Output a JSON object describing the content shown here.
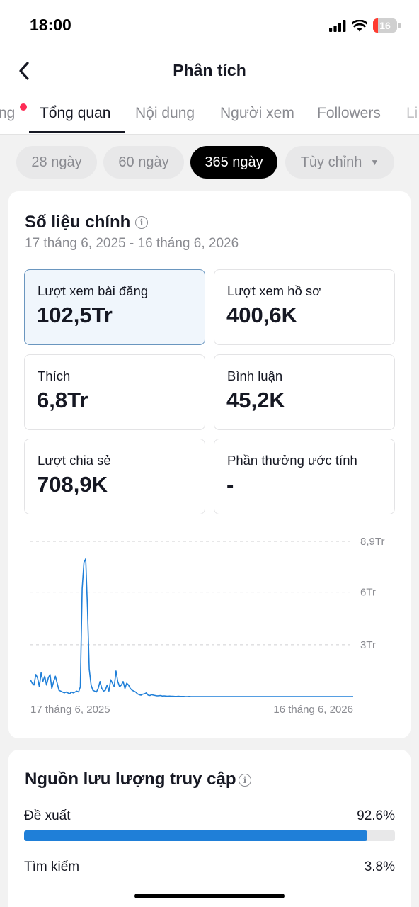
{
  "status_bar": {
    "time": "18:00",
    "battery": "16",
    "icons": [
      "signal-icon",
      "wifi-icon",
      "battery-icon"
    ]
  },
  "header": {
    "title": "Phân tích",
    "back_icon": "chevron-left-icon"
  },
  "tabs": [
    {
      "label": "ng",
      "active": false
    },
    {
      "label": "Tổng quan",
      "active": true
    },
    {
      "label": "Nội dung",
      "active": false
    },
    {
      "label": "Người xem",
      "active": false
    },
    {
      "label": "Followers",
      "active": false
    },
    {
      "label": "Li",
      "active": false
    }
  ],
  "periods": [
    {
      "label": "28 ngày",
      "active": false
    },
    {
      "label": "60 ngày",
      "active": false
    },
    {
      "label": "365 ngày",
      "active": true
    },
    {
      "label": "Tùy chỉnh",
      "active": false,
      "dropdown": true
    }
  ],
  "key_metrics": {
    "title": "Số liệu chính",
    "date_range": "17 tháng 6, 2025 - 16 tháng 6, 2026",
    "cards": [
      {
        "label": "Lượt xem bài đăng",
        "value": "102,5Tr",
        "selected": true
      },
      {
        "label": "Lượt xem hồ sơ",
        "value": "400,6K",
        "selected": false
      },
      {
        "label": "Thích",
        "value": "6,8Tr",
        "selected": false
      },
      {
        "label": "Bình luận",
        "value": "45,2K",
        "selected": false
      },
      {
        "label": "Lượt chia sẻ",
        "value": "708,9K",
        "selected": false
      },
      {
        "label": "Phần thưởng ước tính",
        "value": "-",
        "selected": false
      }
    ]
  },
  "chart_data": {
    "type": "line",
    "title": "",
    "xlabel": "",
    "ylabel": "",
    "y_ticks": [
      "8,9Tr",
      "6Tr",
      "3Tr"
    ],
    "x_ticks": [
      "17 tháng 6, 2025",
      "16 tháng 6, 2026"
    ],
    "ylim": [
      0,
      8.9
    ],
    "unit": "Tr",
    "grid": "dashed horizontal",
    "color": "#1f7fd8",
    "series": [
      {
        "values": [
          1.0,
          0.8,
          0.7,
          1.3,
          1.1,
          0.6,
          1.4,
          0.9,
          1.2,
          0.7,
          1.1,
          1.3,
          0.5,
          0.9,
          1.2,
          0.8,
          0.4,
          0.35,
          0.3,
          0.25,
          0.3,
          0.25,
          0.2,
          0.3,
          0.25,
          0.3,
          0.35,
          0.3,
          0.6,
          6.2,
          7.7,
          7.9,
          5.1,
          1.6,
          0.7,
          0.4,
          0.35,
          0.3,
          0.5,
          0.9,
          0.5,
          0.35,
          0.4,
          0.7,
          0.35,
          1.0,
          0.8,
          0.6,
          1.5,
          0.9,
          0.6,
          0.7,
          0.9,
          0.5,
          0.8,
          0.7,
          0.5,
          0.4,
          0.35,
          0.3,
          0.2,
          0.15,
          0.12,
          0.18,
          0.2,
          0.25,
          0.12,
          0.1,
          0.15,
          0.12,
          0.1,
          0.08,
          0.09,
          0.1,
          0.07,
          0.08,
          0.07,
          0.06,
          0.07,
          0.06,
          0.06,
          0.05,
          0.05,
          0.06,
          0.05,
          0.05,
          0.05,
          0.04,
          0.04,
          0.05,
          0.04,
          0.04,
          0.04,
          0.04,
          0.04,
          0.04,
          0.04,
          0.04,
          0.04,
          0.04,
          0.04,
          0.04,
          0.04,
          0.04,
          0.04,
          0.04,
          0.04,
          0.04,
          0.04,
          0.04,
          0.04,
          0.04,
          0.04,
          0.04,
          0.04,
          0.04,
          0.04,
          0.04,
          0.04,
          0.04,
          0.04,
          0.04,
          0.04,
          0.04,
          0.04,
          0.04,
          0.04,
          0.04,
          0.04,
          0.04,
          0.04,
          0.04,
          0.04,
          0.04,
          0.04,
          0.04,
          0.04,
          0.04,
          0.04,
          0.04,
          0.04,
          0.04,
          0.04,
          0.04,
          0.04,
          0.04,
          0.04,
          0.04,
          0.04,
          0.04,
          0.04,
          0.04,
          0.04,
          0.04,
          0.04,
          0.04,
          0.04,
          0.04,
          0.04,
          0.04,
          0.04,
          0.04,
          0.04,
          0.04,
          0.04,
          0.04,
          0.04,
          0.04,
          0.04,
          0.04,
          0.04,
          0.04,
          0.04,
          0.04,
          0.04,
          0.04,
          0.04,
          0.04,
          0.04,
          0.04,
          0.04,
          0.04
        ]
      }
    ]
  },
  "traffic": {
    "title": "Nguồn lưu lượng truy cập",
    "rows": [
      {
        "label": "Đề xuất",
        "value": "92.6%",
        "fraction": 0.926
      },
      {
        "label": "Tìm kiếm",
        "value": "3.8%",
        "fraction": 0.038
      }
    ]
  }
}
